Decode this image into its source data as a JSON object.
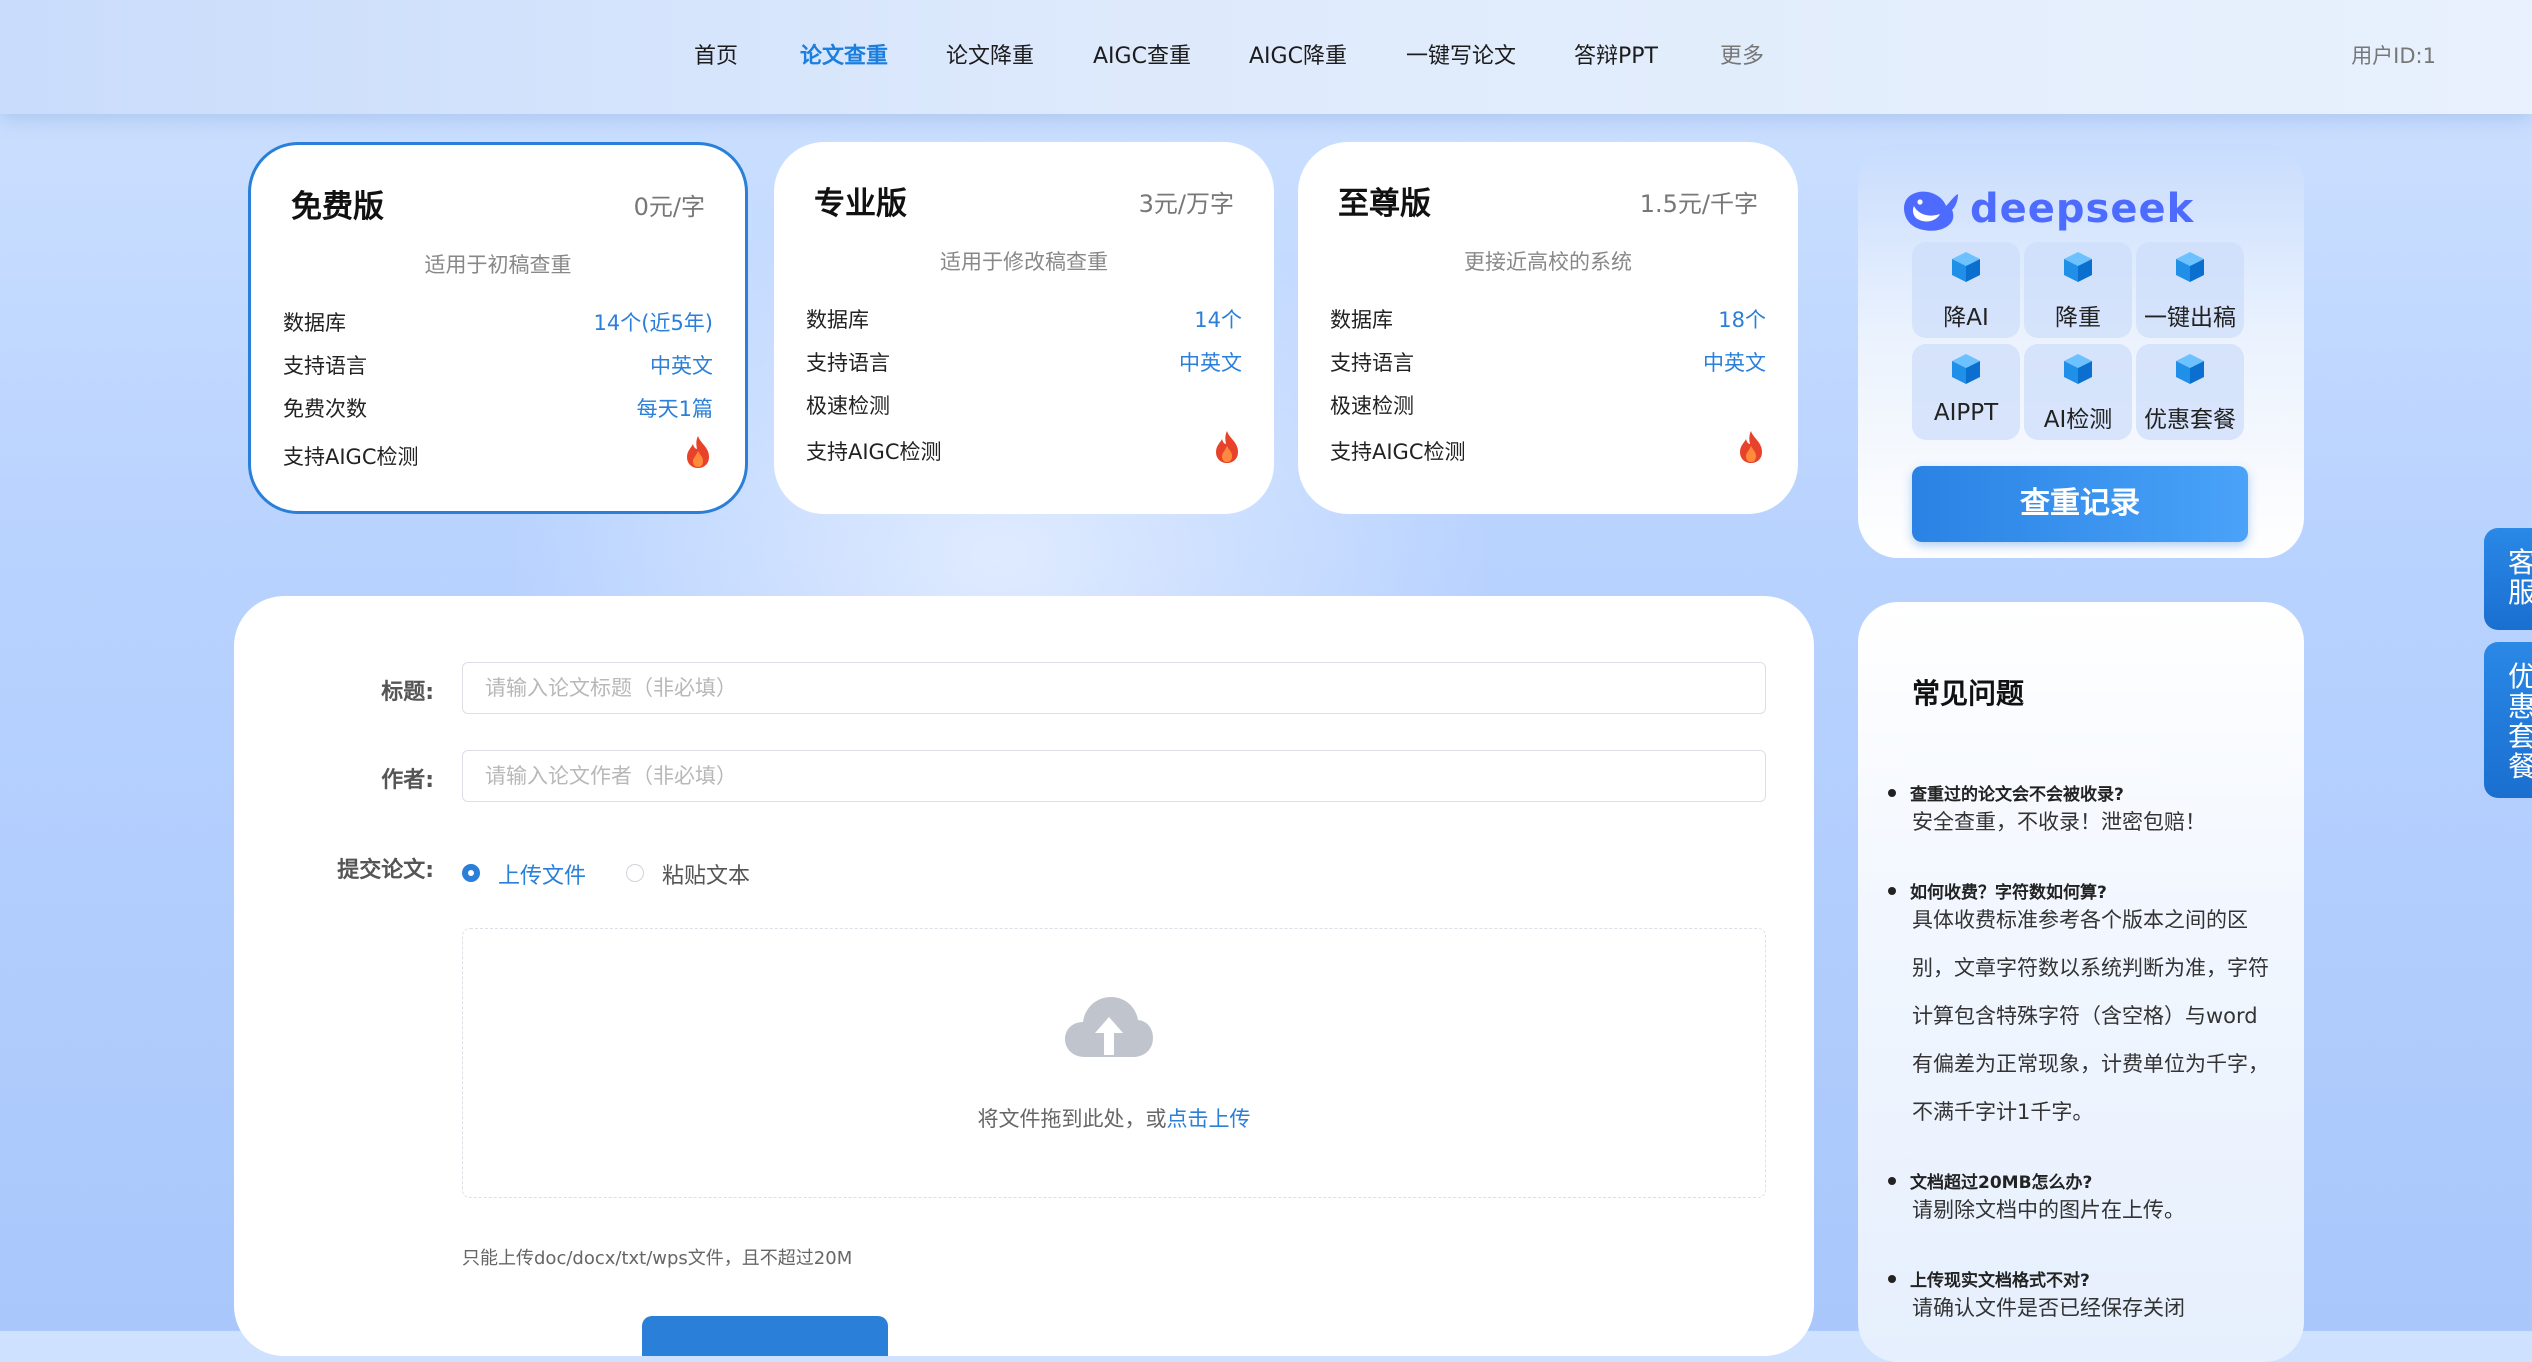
{
  "nav": {
    "items": [
      {
        "label": "首页"
      },
      {
        "label": "论文查重"
      },
      {
        "label": "论文降重"
      },
      {
        "label": "AIGC查重"
      },
      {
        "label": "AIGC降重"
      },
      {
        "label": "一键写论文"
      },
      {
        "label": "答辩PPT"
      },
      {
        "label": "更多"
      }
    ],
    "active_index": 1,
    "user_id": "用户ID:1"
  },
  "plans": [
    {
      "name": "免费版",
      "price": "0元/字",
      "desc": "适用于初稿查重",
      "selected": true,
      "rows": [
        {
          "label": "数据库",
          "value": "14个(近5年)"
        },
        {
          "label": "支持语言",
          "value": "中英文"
        },
        {
          "label": "免费次数",
          "value": "每天1篇"
        },
        {
          "label": "支持AIGC检测",
          "icon": "fire-icon"
        }
      ]
    },
    {
      "name": "专业版",
      "price": "3元/万字",
      "desc": "适用于修改稿查重",
      "selected": false,
      "rows": [
        {
          "label": "数据库",
          "value": "14个"
        },
        {
          "label": "支持语言",
          "value": "中英文"
        },
        {
          "label": "极速检测",
          "value": ""
        },
        {
          "label": "支持AIGC检测",
          "icon": "fire-icon"
        }
      ]
    },
    {
      "name": "至尊版",
      "price": "1.5元/千字",
      "desc": "更接近高校的系统",
      "selected": false,
      "rows": [
        {
          "label": "数据库",
          "value": "18个"
        },
        {
          "label": "支持语言",
          "value": "中英文"
        },
        {
          "label": "极速检测",
          "value": ""
        },
        {
          "label": "支持AIGC检测",
          "icon": "fire-icon"
        }
      ]
    }
  ],
  "deepseek": {
    "brand": "deepseek",
    "tools": [
      {
        "label": "降AI",
        "icon": "cube-icon"
      },
      {
        "label": "降重",
        "icon": "cube-icon"
      },
      {
        "label": "一键出稿",
        "icon": "cube-icon"
      },
      {
        "label": "AIPPT",
        "icon": "cube-icon"
      },
      {
        "label": "AI检测",
        "icon": "cube-icon"
      },
      {
        "label": "优惠套餐",
        "icon": "cube-icon"
      }
    ],
    "record_button": "查重记录"
  },
  "form": {
    "title_label": "标题:",
    "title_placeholder": "请输入论文标题（非必填）",
    "author_label": "作者:",
    "author_placeholder": "请输入论文作者（非必填）",
    "submit_label": "提交论文:",
    "options": [
      {
        "label": "上传文件",
        "checked": true
      },
      {
        "label": "粘贴文本",
        "checked": false
      }
    ],
    "drop_text": "将文件拖到此处，或",
    "drop_link": "点击上传",
    "hint": "只能上传doc/docx/txt/wps文件，且不超过20M"
  },
  "faq": {
    "title": "常见问题",
    "items": [
      {
        "q": "查重过的论文会不会被收录?",
        "a": "安全查重，不收录！泄密包赔！"
      },
      {
        "q": "如何收费？字符数如何算?",
        "a": "具体收费标准参考各个版本之间的区别，文章字符数以系统判断为准，字符计算包含特殊字符（含空格）与word有偏差为正常现象，计费单位为千字，不满千字计1千字。"
      },
      {
        "q": "文档超过20MB怎么办?",
        "a": "请剔除文档中的图片在上传。"
      },
      {
        "q": "上传现实文档格式不对?",
        "a": "请确认文件是否已经保存关闭"
      }
    ]
  },
  "side_tabs": [
    {
      "label": "客服"
    },
    {
      "label": "优惠套餐"
    }
  ],
  "colors": {
    "accent": "#2a7fd9",
    "deepseek_brand": "#4d6bfe",
    "fire": "#e8432a"
  }
}
